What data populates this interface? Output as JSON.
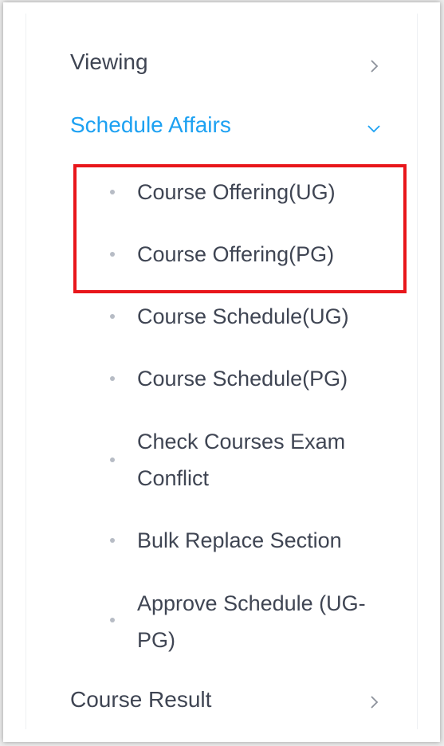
{
  "menu": {
    "viewing": {
      "label": "Viewing",
      "icon": "chevron-right-icon"
    },
    "schedule_affairs": {
      "label": "Schedule Affairs",
      "icon": "chevron-down-icon",
      "expanded": true,
      "active_color": "#1da1f2",
      "items": [
        {
          "label": "Course Offering(UG)"
        },
        {
          "label": "Course Offering(PG)"
        },
        {
          "label": "Course Schedule(UG)"
        },
        {
          "label": "Course Schedule(PG)"
        },
        {
          "label": "Check Courses Exam Conflict"
        },
        {
          "label": "Bulk Replace Section"
        },
        {
          "label": "Approve Schedule (UG-PG)"
        }
      ]
    },
    "course_result": {
      "label": "Course Result",
      "icon": "chevron-right-icon"
    }
  },
  "annotation": {
    "highlight_color": "#e8161b"
  }
}
